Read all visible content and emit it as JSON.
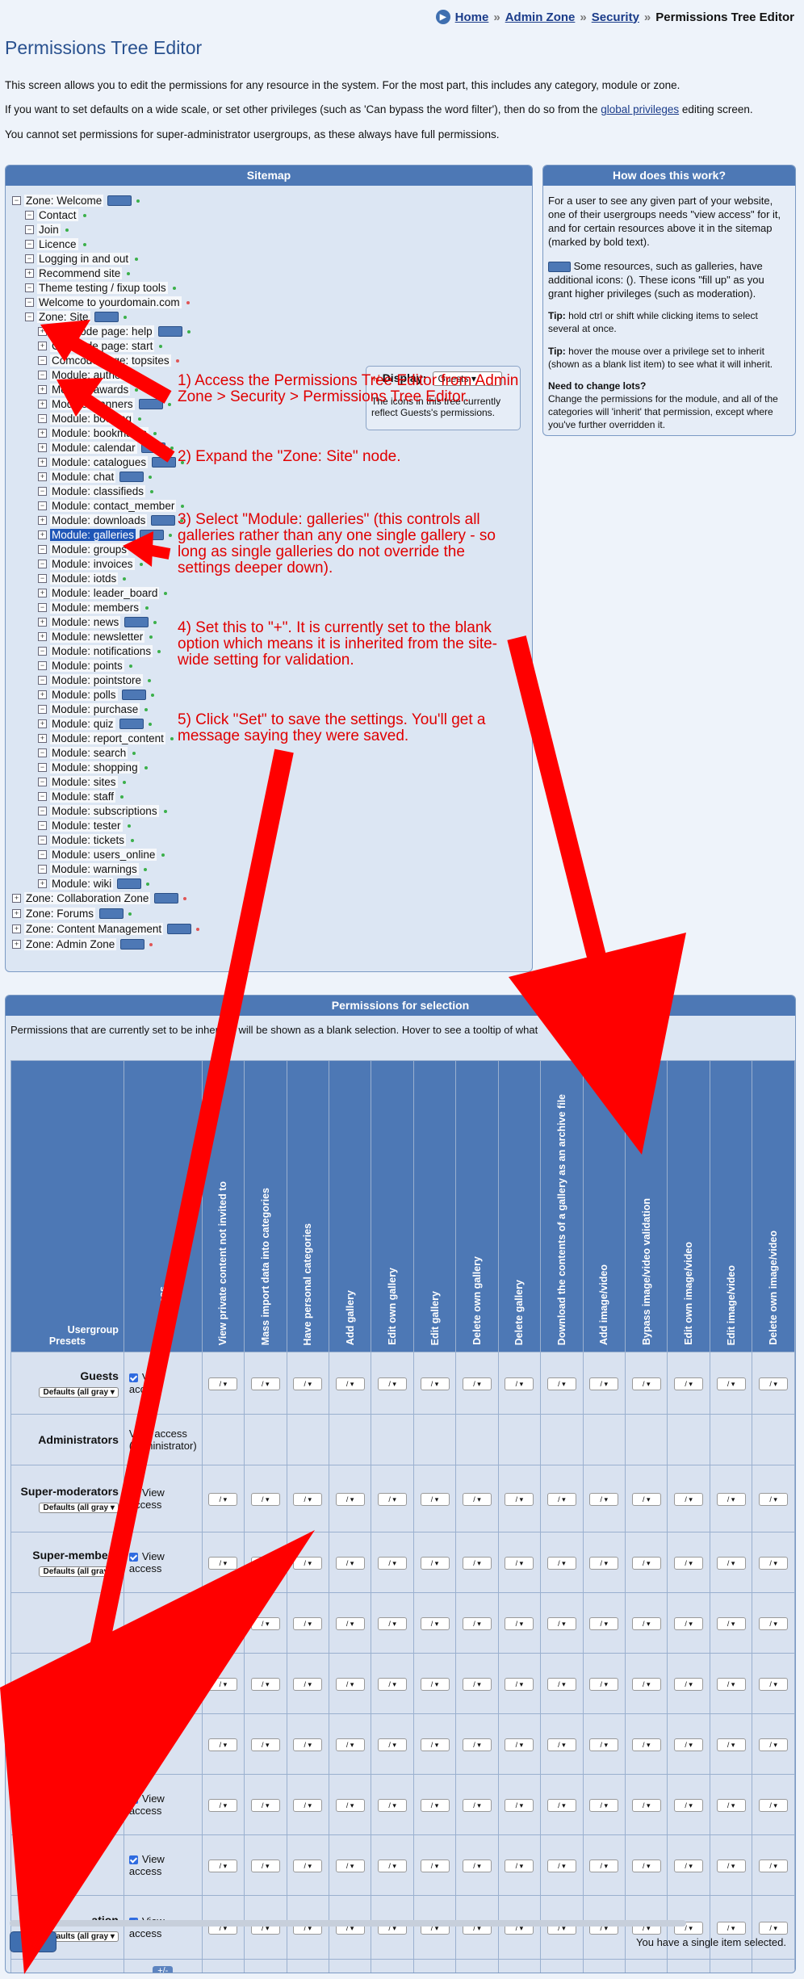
{
  "breadcrumb": {
    "home": "Home",
    "admin": "Admin Zone",
    "security": "Security",
    "current": "Permissions Tree Editor",
    "sep": "»"
  },
  "page": {
    "title": "Permissions Tree Editor",
    "intro1": "This screen allows you to edit the permissions for any resource in the system. For the most part, this includes any category, module or zone.",
    "intro2a": "If you want to set defaults on a wide scale, or set other privileges (such as 'Can bypass the word filter'), then do so from the ",
    "intro2link": "global privileges",
    "intro2b": " editing screen.",
    "intro3": "You cannot set permissions for super-administrator usergroups, as these always have full permissions."
  },
  "sitemap": {
    "title": "Sitemap",
    "display_label": "Display:",
    "display_value": "Guests",
    "display_note": "The icons in this tree currently reflect Guests's permissions.",
    "nodes": [
      "Zone: Welcome",
      "Contact",
      "Join",
      "Licence",
      "Logging in and out",
      "Recommend site",
      "Theme testing / fixup tools",
      "Welcome to yourdomain.com",
      "Zone: Site",
      "Comcode page: help",
      "Comcode page: start",
      "Comcode page: topsites",
      "Module: authors",
      "Module: awards",
      "Module: banners",
      "Module: booking",
      "Module: bookmarks",
      "Module: calendar",
      "Module: catalogues",
      "Module: chat",
      "Module: classifieds",
      "Module: contact_member",
      "Module: downloads",
      "Module: galleries",
      "Module: groups",
      "Module: invoices",
      "Module: iotds",
      "Module: leader_board",
      "Module: members",
      "Module: news",
      "Module: newsletter",
      "Module: notifications",
      "Module: points",
      "Module: pointstore",
      "Module: polls",
      "Module: purchase",
      "Module: quiz",
      "Module: report_content",
      "Module: search",
      "Module: shopping",
      "Module: sites",
      "Module: staff",
      "Module: subscriptions",
      "Module: tester",
      "Module: tickets",
      "Module: users_online",
      "Module: warnings",
      "Module: wiki",
      "Zone: Collaboration Zone",
      "Zone: Forums",
      "Zone: Content Management",
      "Zone: Admin Zone"
    ]
  },
  "how": {
    "title": "How does this work?",
    "p1": "For a user to see any given part of your website, one of their usergroups needs \"view access\" for it, and for certain resources above it in the sitemap (marked by bold text).",
    "p2": "Some resources, such as galleries, have additional icons: (). These icons \"fill up\" as you grant higher privileges (such as moderation).",
    "tip1l": "Tip:",
    "tip1": " hold ctrl or shift while clicking items to select several at once.",
    "tip2l": "Tip:",
    "tip2": " hover the mouse over a privilege set to inherit (shown as a blank list item) to see what it will inherit.",
    "lotsl": "Need to change lots?",
    "lots": "Change the permissions for the module, and all of the categories will 'inherit' that permission, except where you've further overridden it."
  },
  "perm": {
    "title": "Permissions for selection",
    "info": "Permissions that are currently set to be inherited will be shown as a blank selection. Hover to see a tooltip of what",
    "usergroup_header": "Usergroup",
    "presets_header": "Presets",
    "columns": [
      "View access",
      "View private content not invited to",
      "Mass import data into categories",
      "Have personal categories",
      "Add gallery",
      "Edit own gallery",
      "Edit gallery",
      "Delete own gallery",
      "Delete gallery",
      "Download the contents of a gallery as an archive file",
      "Add image/video",
      "Bypass image/video validation",
      "Edit own image/video",
      "Edit image/video",
      "Delete own image/video"
    ],
    "rows": [
      {
        "name": "Guests",
        "preset": "Defaults (all gray",
        "view": "View access"
      },
      {
        "name": "Administrators",
        "view": "View access (administrator)"
      },
      {
        "name": "Super-moderators",
        "preset": "Defaults (all gray",
        "view": "View access"
      },
      {
        "name": "Super-members",
        "preset": "Defaults (all gray",
        "view": "View access"
      },
      {
        "name": "",
        "view": ""
      },
      {
        "name": "",
        "view": ""
      },
      {
        "name": "",
        "view": ""
      },
      {
        "name": "",
        "view": "View access"
      },
      {
        "name": "",
        "view": "View access"
      },
      {
        "name": "…ation",
        "preset": "Defaults (all gray",
        "view": "View access"
      }
    ],
    "plusminus": "+/-",
    "select_placeholder": "/",
    "set_button": "Set",
    "selected_info": "You have a single item selected."
  },
  "notes": {
    "n1": "1) Access the Permissions Tree Editor from Admin Zone > Security > Permissions Tree Editor.",
    "n2": "2) Expand the \"Zone: Site\" node.",
    "n3": "3) Select \"Module: galleries\" (this controls all galleries rather than any one single gallery - so long as single galleries do not override the settings deeper down).",
    "n4": "4) Set this to \"+\". It is currently set to the blank option which means it is inherited from the site-wide setting for validation.",
    "n5": "5) Click \"Set\" to save the settings. You'll get a message saying they were saved."
  }
}
